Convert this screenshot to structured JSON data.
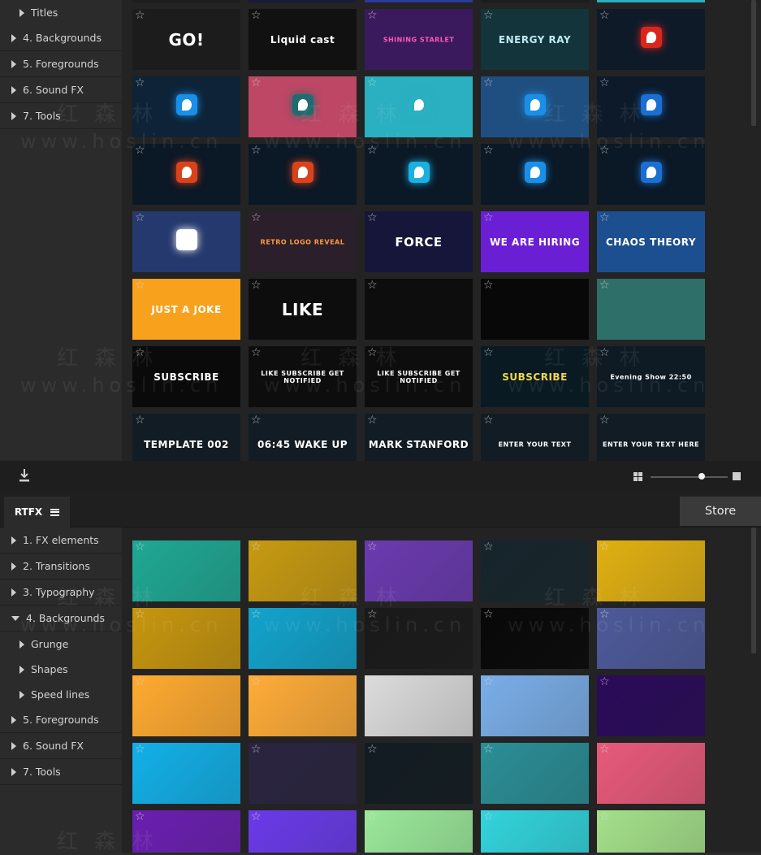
{
  "top_sidebar": {
    "items": [
      {
        "label": "Titles",
        "child": true
      },
      {
        "label": "4. Backgrounds"
      },
      {
        "label": "5. Foregrounds"
      },
      {
        "label": "6. Sound FX"
      },
      {
        "label": "7. Tools"
      }
    ]
  },
  "top_grid": {
    "rows": [
      [
        {
          "text": "GO!",
          "bg": "#1c1c1c",
          "fg": "#ffffff"
        },
        {
          "text": "Liquid cast",
          "bg": "#111111",
          "fg": "#ffffff"
        },
        {
          "text": "SHINING STARLET",
          "bg": "#3a1a5c",
          "fg": "#ff5ab4"
        },
        {
          "text": "ENERGY RAY",
          "bg": "#12343a",
          "fg": "#bfe9f2"
        },
        {
          "text": "",
          "bg": "#0f1a29",
          "fg": "#ffffff",
          "logo": "#d9261c"
        }
      ],
      [
        {
          "text": "",
          "bg": "#0e2337",
          "fg": "#ffffff",
          "logo": "#1a8fe8"
        },
        {
          "text": "",
          "bg": "#bd4764",
          "fg": "#ffffff",
          "logo": "#1f6b6f"
        },
        {
          "text": "",
          "bg": "#2ab0c0",
          "fg": "#ffffff",
          "logo": "#2ab0c0"
        },
        {
          "text": "",
          "bg": "#1f4f80",
          "fg": "#ffffff",
          "logo": "#1a8fe8"
        },
        {
          "text": "",
          "bg": "#0c1a2a",
          "fg": "#ffffff",
          "logo": "#1a6fd0"
        }
      ],
      [
        {
          "text": "",
          "bg": "#0b1826",
          "fg": "#ffffff",
          "logo": "#d9431c"
        },
        {
          "text": "",
          "bg": "#0b1826",
          "fg": "#ffffff",
          "logo": "#d9431c"
        },
        {
          "text": "",
          "bg": "#0b1826",
          "fg": "#ffffff",
          "logo": "#1ab0e0"
        },
        {
          "text": "",
          "bg": "#0b1826",
          "fg": "#ffffff",
          "logo": "#1a8fe8"
        },
        {
          "text": "",
          "bg": "#0b1826",
          "fg": "#ffffff",
          "logo": "#1a6fd0"
        }
      ],
      [
        {
          "text": "",
          "bg": "#25396e",
          "fg": "#ffffff",
          "logo": "#ffffff"
        },
        {
          "text": "RETRO LOGO REVEAL",
          "bg": "#2a1f2a",
          "fg": "#ff9a3c"
        },
        {
          "text": "FORCE",
          "bg": "#16163a",
          "fg": "#ffffff"
        },
        {
          "text": "WE ARE HIRING",
          "bg": "#6a1fd4",
          "fg": "#ffffff"
        },
        {
          "text": "CHAOS THEORY",
          "bg": "#1c4f8f",
          "fg": "#ffffff"
        }
      ],
      [
        {
          "text": "JUST A JOKE",
          "bg": "#f8a11c",
          "fg": "#ffffff"
        },
        {
          "text": "LIKE",
          "bg": "#0d0d0d",
          "fg": "#ffffff"
        },
        {
          "text": "",
          "bg": "#0d0d0d",
          "fg": "#ffffff"
        },
        {
          "text": "",
          "bg": "#080808",
          "fg": "#ffffff"
        },
        {
          "text": "",
          "bg": "#2e6f69",
          "fg": "#ffffff"
        }
      ],
      [
        {
          "text": "SUBSCRIBE",
          "bg": "#0a0a0a",
          "fg": "#ffffff"
        },
        {
          "text": "LIKE SUBSCRIBE GET NOTIFIED",
          "bg": "#0d0d0d",
          "fg": "#ffffff"
        },
        {
          "text": "LIKE SUBSCRIBE GET NOTIFIED",
          "bg": "#0d0d0d",
          "fg": "#ffffff"
        },
        {
          "text": "SUBSCRIBE",
          "bg": "#0a1a22",
          "fg": "#f0d84a"
        },
        {
          "text": "Evening Show 22:50",
          "bg": "#0e1a24",
          "fg": "#ffffff"
        }
      ],
      [
        {
          "text": "TEMPLATE 002",
          "bg": "#121c24",
          "fg": "#ffffff"
        },
        {
          "text": "06:45 WAKE UP",
          "bg": "#121c24",
          "fg": "#ffffff"
        },
        {
          "text": "MARK STANFORD",
          "bg": "#121c24",
          "fg": "#ffffff"
        },
        {
          "text": "ENTER YOUR TEXT",
          "bg": "#121c24",
          "fg": "#ffffff"
        },
        {
          "text": "ENTER YOUR TEXT HERE",
          "bg": "#121c24",
          "fg": "#ffffff"
        }
      ]
    ]
  },
  "tabs": {
    "rtfx_label": "RTFX",
    "store_label": "Store"
  },
  "bottom_sidebar": {
    "items": [
      {
        "label": "1. FX elements",
        "open": false
      },
      {
        "label": "2. Transitions",
        "open": false
      },
      {
        "label": "3. Typography",
        "open": false
      },
      {
        "label": "4. Backgrounds",
        "open": true
      },
      {
        "label": "Grunge",
        "child": true
      },
      {
        "label": "Shapes",
        "child": true
      },
      {
        "label": "Speed lines",
        "child": true
      },
      {
        "label": "5. Foregrounds",
        "open": false
      },
      {
        "label": "6. Sound FX",
        "open": false
      },
      {
        "label": "7. Tools",
        "open": false
      }
    ]
  },
  "bottom_grid": {
    "rows": [
      [
        "#1fa894",
        "#c79a12",
        "#6a3ab0",
        "#16252c",
        "#e0b012"
      ],
      [
        "#c7960e",
        "#12a3cc",
        "#1a1a1a",
        "#080808",
        "#4d5a9a"
      ],
      [
        "#ffaa30",
        "#ffac38",
        "#dcdcdc",
        "#7aaee8",
        "#2a0a5a"
      ],
      [
        "#12b0e8",
        "#2a2440",
        "#121c22",
        "#2a8e96",
        "#e85a7a"
      ],
      [
        "#6a1fb0",
        "#6a3ae8",
        "#9ae89a",
        "#32d4dc",
        "#a4e08a"
      ]
    ]
  },
  "colors": {
    "accent": "#ffffff",
    "panel": "#2b2b2b",
    "grid_bg": "#232323"
  }
}
